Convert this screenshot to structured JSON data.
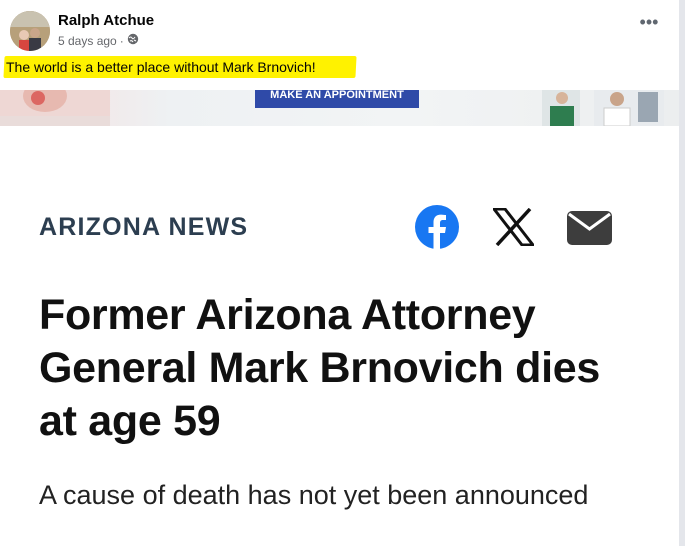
{
  "post": {
    "author": "Ralph Atchue",
    "time": "5 days ago",
    "separator": "·",
    "audience_icon": "globe-icon",
    "more_icon": "more-options-icon",
    "more_glyph": "•••",
    "text": "The world is a better place without Mark Brnovich!",
    "highlight_color": "#fff200"
  },
  "banner": {
    "appointment_label": "MAKE AN APPOINTMENT",
    "button_color": "#2f4aa8"
  },
  "article": {
    "section": "ARIZONA NEWS",
    "headline": "Former Arizona Attorney General Mark Brnovich dies at age 59",
    "subheadline": "A cause of death has not yet been announced",
    "share_icons": [
      "facebook-icon",
      "x-icon",
      "mail-icon"
    ],
    "facebook_color": "#1877f2",
    "section_color": "#2c3e50"
  }
}
